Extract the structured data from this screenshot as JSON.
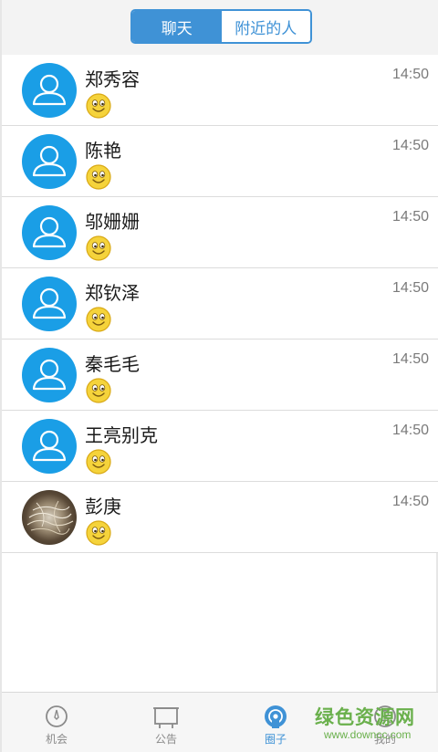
{
  "header": {
    "tabs": [
      {
        "label": "聊天",
        "active": true
      },
      {
        "label": "附近的人",
        "active": false
      }
    ]
  },
  "chats": [
    {
      "name": "郑秀容",
      "time": "14:50",
      "avatar": "person-icon",
      "preview": "smile-emoji"
    },
    {
      "name": "陈艳",
      "time": "14:50",
      "avatar": "person-icon",
      "preview": "smile-emoji"
    },
    {
      "name": "邬姗姗",
      "time": "14:50",
      "avatar": "person-icon",
      "preview": "smile-emoji"
    },
    {
      "name": "郑钦泽",
      "time": "14:50",
      "avatar": "person-icon",
      "preview": "smile-emoji"
    },
    {
      "name": "秦毛毛",
      "time": "14:50",
      "avatar": "person-icon",
      "preview": "smile-emoji"
    },
    {
      "name": "王亮别克",
      "time": "14:50",
      "avatar": "person-icon",
      "preview": "smile-emoji"
    },
    {
      "name": "彭庚",
      "time": "14:50",
      "avatar": "photo",
      "preview": "smile-emoji"
    }
  ],
  "tabbar": {
    "items": [
      {
        "label": "机会",
        "icon": "compass-icon",
        "active": false
      },
      {
        "label": "公告",
        "icon": "board-icon",
        "active": false
      },
      {
        "label": "圈子",
        "icon": "circle-icon",
        "active": true
      },
      {
        "label": "我的",
        "icon": "profile-icon",
        "active": false
      }
    ]
  },
  "watermark": {
    "main": "绿色资源网",
    "sub": "www.downcc.com"
  },
  "colors": {
    "accent": "#3f92d6",
    "avatar_blue": "#1a9ee6",
    "watermark_green": "#6ab04c"
  }
}
